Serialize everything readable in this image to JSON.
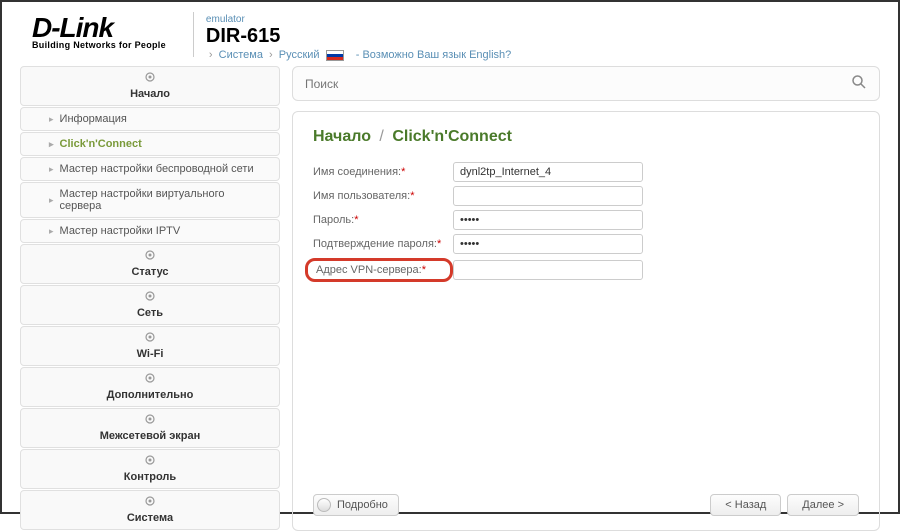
{
  "header": {
    "logo_main": "D-Link",
    "logo_sub": "Building Networks for People",
    "emulator": "emulator",
    "model": "DIR-615",
    "crumb_system": "Система",
    "crumb_lang": "Русский",
    "lang_question": "- Возможно Ваш язык English?"
  },
  "sidebar": {
    "items": [
      {
        "label": "Начало",
        "main": true
      },
      {
        "label": "Информация",
        "sub": true
      },
      {
        "label": "Click'n'Connect",
        "sub": true,
        "active": true
      },
      {
        "label": "Мастер настройки беспроводной сети",
        "sub": true
      },
      {
        "label": "Мастер настройки виртуального сервера",
        "sub": true
      },
      {
        "label": "Мастер настройки IPTV",
        "sub": true
      },
      {
        "label": "Статус",
        "main": true
      },
      {
        "label": "Сеть",
        "main": true
      },
      {
        "label": "Wi-Fi",
        "main": true
      },
      {
        "label": "Дополнительно",
        "main": true
      },
      {
        "label": "Межсетевой экран",
        "main": true
      },
      {
        "label": "Контроль",
        "main": true
      },
      {
        "label": "Система",
        "main": true
      }
    ]
  },
  "search": {
    "placeholder": "Поиск"
  },
  "breadcrumb": {
    "root": "Начало",
    "page": "Click'n'Connect"
  },
  "form": {
    "conn_name_label": "Имя соединения:",
    "conn_name_value": "dynl2tp_Internet_4",
    "username_label": "Имя пользователя:",
    "username_value": "",
    "password_label": "Пароль:",
    "password_value": "•••••",
    "password_confirm_label": "Подтверждение пароля:",
    "password_confirm_value": "•••••",
    "vpn_label": "Адрес VPN-сервера:",
    "vpn_value": ""
  },
  "buttons": {
    "details": "Подробно",
    "back": "< Назад",
    "next": "Далее >"
  }
}
